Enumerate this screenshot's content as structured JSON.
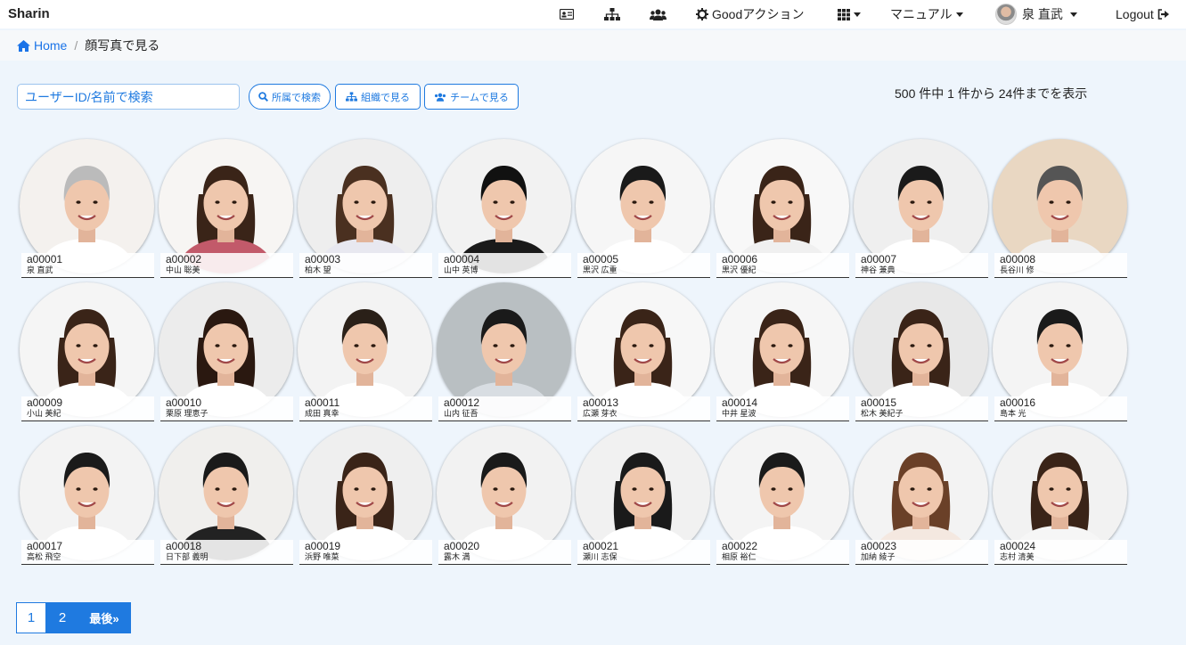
{
  "brand": "Sharin",
  "nav": {
    "good_action": "Goodアクション",
    "manual": "マニュアル",
    "user_name": "泉 直武",
    "logout": "Logout"
  },
  "breadcrumb": {
    "home": "Home",
    "current": "顔写真で見る"
  },
  "search": {
    "placeholder": "ユーザーID/名前で検索",
    "btn_affiliation": "所属で検索",
    "btn_org": "組織で見る",
    "btn_team": "チームで見る"
  },
  "result_count": "500 件中 1 件から 24件までを表示",
  "colors": {
    "accent": "#1f7ae0",
    "page_bg": "#eef5fc"
  },
  "users": [
    {
      "id": "a00001",
      "name": "泉 直武"
    },
    {
      "id": "a00002",
      "name": "中山 聡美"
    },
    {
      "id": "a00003",
      "name": "柏木 望"
    },
    {
      "id": "a00004",
      "name": "山中 英博"
    },
    {
      "id": "a00005",
      "name": "黒沢 広重"
    },
    {
      "id": "a00006",
      "name": "黒沢 優紀"
    },
    {
      "id": "a00007",
      "name": "神谷 兼典"
    },
    {
      "id": "a00008",
      "name": "長谷川 修"
    },
    {
      "id": "a00009",
      "name": "小山 美紀"
    },
    {
      "id": "a00010",
      "name": "栗原 理恵子"
    },
    {
      "id": "a00011",
      "name": "成田 真幸"
    },
    {
      "id": "a00012",
      "name": "山内 征吾"
    },
    {
      "id": "a00013",
      "name": "広瀬 芽衣"
    },
    {
      "id": "a00014",
      "name": "中井 星波"
    },
    {
      "id": "a00015",
      "name": "松木 美紀子"
    },
    {
      "id": "a00016",
      "name": "島本 光"
    },
    {
      "id": "a00017",
      "name": "高松 飛空"
    },
    {
      "id": "a00018",
      "name": "日下部 義明"
    },
    {
      "id": "a00019",
      "name": "浜野 唯菜"
    },
    {
      "id": "a00020",
      "name": "露木 満"
    },
    {
      "id": "a00021",
      "name": "瀬川 志保"
    },
    {
      "id": "a00022",
      "name": "相原 裕仁"
    },
    {
      "id": "a00023",
      "name": "加納 綾子"
    },
    {
      "id": "a00024",
      "name": "志村 清美"
    }
  ],
  "pagination": {
    "page1": "1",
    "page2": "2",
    "last": "最後»"
  }
}
